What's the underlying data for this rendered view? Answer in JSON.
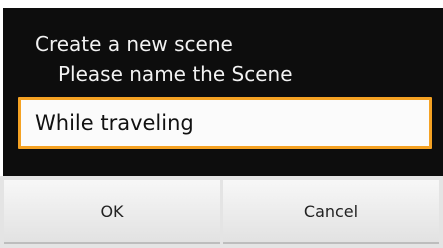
{
  "dialog": {
    "title": "Create a new scene",
    "message": "Please name the Scene",
    "input": {
      "value": "While traveling"
    },
    "buttons": {
      "ok_label": "OK",
      "cancel_label": "Cancel"
    },
    "colors": {
      "body_background": "#0d0d0d",
      "input_focus_border": "#f5a223",
      "button_bar_background": "#e4e4e4"
    }
  }
}
